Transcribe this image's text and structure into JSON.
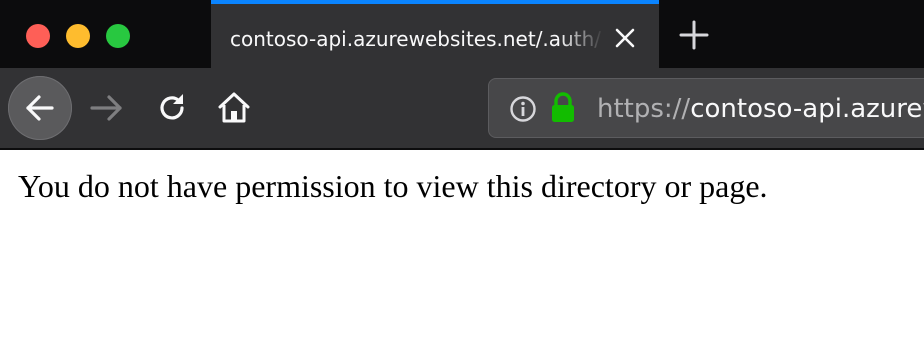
{
  "window": {
    "traffic_lights": [
      "close",
      "minimize",
      "maximize"
    ]
  },
  "tab": {
    "title": "contoso-api.azurewebsites.net/.auth/",
    "close_icon": "close-icon",
    "accent_color": "#0a84ff"
  },
  "new_tab": {
    "icon": "plus-icon"
  },
  "toolbar": {
    "back_icon": "arrow-left-icon",
    "forward_icon": "arrow-right-icon",
    "reload_icon": "reload-icon",
    "home_icon": "home-icon"
  },
  "urlbar": {
    "info_icon": "info-icon",
    "lock_icon": "lock-icon",
    "lock_color": "#12bc00",
    "scheme": "https://",
    "host": "contoso-api.azurew"
  },
  "page": {
    "message": "You do not have permission to view this directory or page."
  }
}
